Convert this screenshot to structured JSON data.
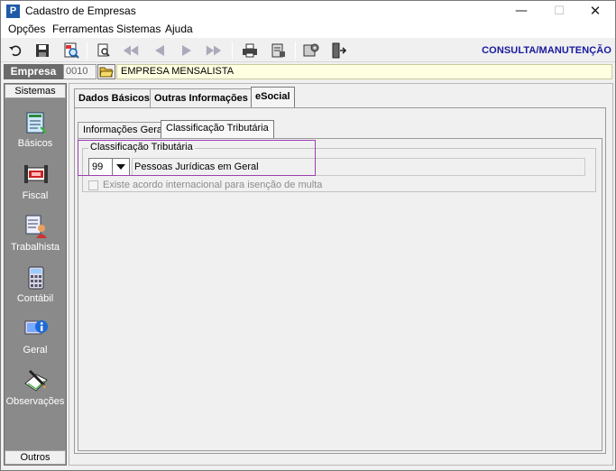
{
  "window": {
    "title": "Cadastro de Empresas",
    "app_icon_letter": "P",
    "minimize": "—",
    "maximize": "☐",
    "close": "✕"
  },
  "menu": [
    "Opções",
    "Ferramentas",
    "Sistemas",
    "Ajuda"
  ],
  "toolbar": {
    "buttons": [
      "undo-icon",
      "save-icon",
      "search-record-icon",
      "preview-icon",
      "first-record-icon",
      "previous-record-icon",
      "next-record-icon",
      "last-record-icon",
      "print-icon",
      "report-icon",
      "configure-icon",
      "exit-icon"
    ],
    "mode_label": "CONSULTA/MANUTENÇÃO"
  },
  "empresa": {
    "label": "Empresa",
    "code": "0010",
    "name": "EMPRESA MENSALISTA"
  },
  "sidebar": {
    "header": "Sistemas",
    "items": [
      {
        "label": "Básicos",
        "icon": "basicos-icon"
      },
      {
        "label": "Fiscal",
        "icon": "fiscal-icon"
      },
      {
        "label": "Trabalhista",
        "icon": "trabalhista-icon"
      },
      {
        "label": "Contábil",
        "icon": "contabil-icon"
      },
      {
        "label": "Geral",
        "icon": "geral-icon"
      },
      {
        "label": "Observações",
        "icon": "observacoes-icon"
      }
    ],
    "footer": "Outros"
  },
  "tabs": {
    "main": [
      "Dados Básicos",
      "Outras Informações",
      "eSocial"
    ],
    "active_main": "eSocial",
    "sub": [
      "Informações Gerais",
      "Classificação Tributária"
    ],
    "active_sub": "Classificação Tributária"
  },
  "classificacao": {
    "group_title": "Classificação Tributária",
    "code": "99",
    "description": "Pessoas Jurídicas em Geral",
    "checkbox_label": "Existe acordo internacional para isenção de multa",
    "checkbox_checked": false
  },
  "colors": {
    "mode_label": "#1a1aa0",
    "empresa_label_bg": "#6b6b6b",
    "empresa_name_bg": "#ffffe1",
    "sidebar_bg": "#8a8a8a",
    "highlight": "#9b3fb0"
  }
}
